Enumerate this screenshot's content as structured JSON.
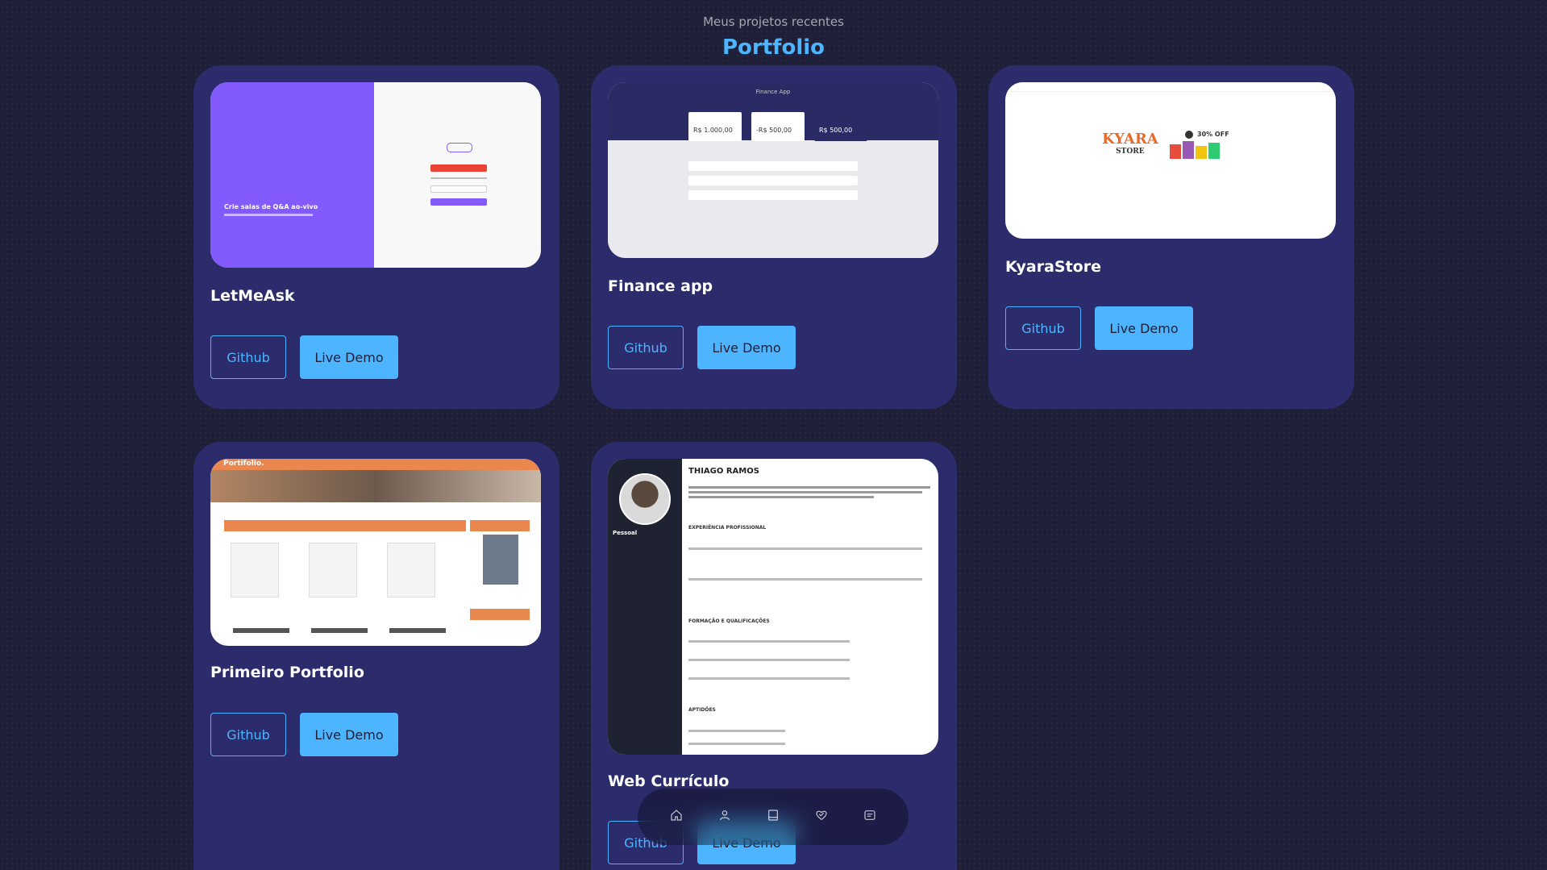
{
  "header": {
    "subtitle": "Meus projetos recentes",
    "title": "Portfolio"
  },
  "projects": [
    {
      "name": "LetMeAsk",
      "github_label": "Github",
      "demo_label": "Live Demo",
      "preview": {
        "heading": "Crie salas de Q&A ao-vivo",
        "logo": "letmeask"
      }
    },
    {
      "name": "Finance app",
      "github_label": "Github",
      "demo_label": "Live Demo",
      "preview": {
        "title": "Finance App",
        "entradas": "R$ 1.000,00",
        "saidas": "-R$ 500,00",
        "total": "R$ 500,00"
      }
    },
    {
      "name": "KyaraStore",
      "github_label": "Github",
      "demo_label": "Live Demo",
      "preview": {
        "logo": "KYARA",
        "logo_sub": "STORE",
        "sale": "30% OFF"
      }
    },
    {
      "name": "Primeiro Portfolio",
      "github_label": "Github",
      "demo_label": "Live Demo",
      "preview": {
        "logo": "Portifolio."
      }
    },
    {
      "name": "Web Currículo",
      "github_label": "Github",
      "demo_label": "Live Demo",
      "preview": {
        "person": "THIAGO RAMOS",
        "sidebar_section": "Pessoal",
        "sections": [
          "EXPERIÊNCIA PROFISSIONAL",
          "FORMAÇÃO E QUALIFICAÇÕES",
          "APTIDÕES"
        ]
      }
    }
  ],
  "bottom_nav": [
    {
      "icon": "home-icon"
    },
    {
      "icon": "user-icon"
    },
    {
      "icon": "book-icon"
    },
    {
      "icon": "services-icon"
    },
    {
      "icon": "message-icon"
    }
  ],
  "colors": {
    "background": "#1f1f38",
    "card": "#2c2c6c",
    "accent": "#4db5ff"
  }
}
